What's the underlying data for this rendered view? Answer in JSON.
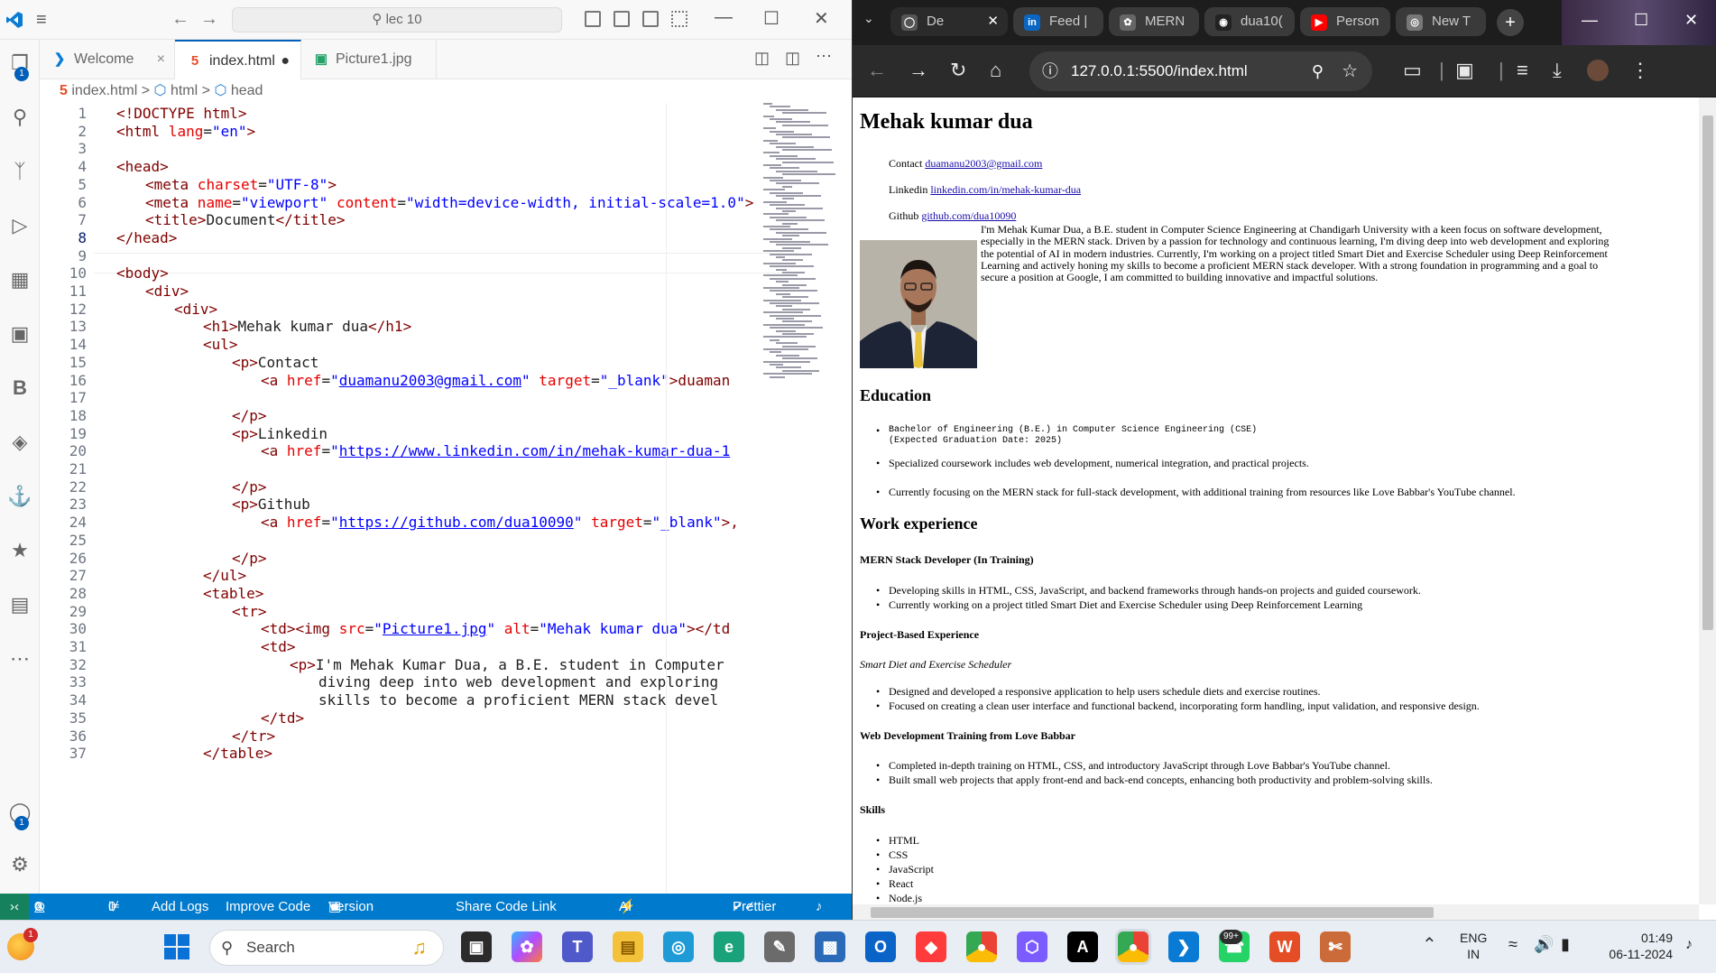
{
  "vscode": {
    "command_center": "lec 10",
    "tabs": [
      {
        "label": "Welcome",
        "icon": "vscode-icon"
      },
      {
        "label": "index.html",
        "icon": "html5-icon"
      },
      {
        "label": "Picture1.jpg",
        "icon": "image-icon"
      }
    ],
    "breadcrumb": {
      "file": "index.html",
      "sep": ">",
      "html": "html",
      "head": "head"
    },
    "line_numbers": [
      "1",
      "2",
      "3",
      "4",
      "5",
      "6",
      "7",
      "8",
      "9",
      "10",
      "11",
      "12",
      "13",
      "14",
      "15",
      "16",
      "17",
      "18",
      "19",
      "20",
      "21",
      "22",
      "23",
      "24",
      "25",
      "26",
      "27",
      "28",
      "29",
      "30",
      "31",
      "32",
      "33",
      "34",
      "35",
      "36",
      "37"
    ],
    "code": {
      "l1": "<!DOCTYPE html>",
      "l2a": "<html",
      "l2b": " lang",
      "l2c": "=",
      "l2d": "\"en\"",
      "l2e": ">",
      "l4": "<head>",
      "l5a": "<meta",
      "l5b": " charset",
      "l5c": "=",
      "l5d": "\"UTF-8\"",
      "l5e": ">",
      "l6a": "<meta",
      "l6b": " name",
      "l6c": "=",
      "l6d": "\"viewport\"",
      "l6e": " content",
      "l6f": "=",
      "l6g": "\"width=device-width, initial-scale=1.0\"",
      "l6h": ">",
      "l7a": "<title>",
      "l7b": "Document",
      "l7c": "</title>",
      "l8": "</head>",
      "l10": "<body>",
      "l11": "<div>",
      "l12": "<div>",
      "l13a": "<h1>",
      "l13b": "Mehak kumar dua",
      "l13c": "</h1>",
      "l14": "<ul>",
      "l15a": "<p>",
      "l15b": "Contact",
      "l16a": "<a",
      "l16b": " href",
      "l16c": "=",
      "l16d": "\"",
      "l16e": "duamanu2003@gmail.com",
      "l16f": "\"",
      "l16g": " target",
      "l16h": "=",
      "l16i": "\"_blank\"",
      "l16j": ">duaman",
      "l18": "</p>",
      "l19a": "<p>",
      "l19b": "Linkedin",
      "l20a": "<a",
      "l20b": " href",
      "l20c": "=",
      "l20d": "\"",
      "l20e": "https://www.linkedin.com/in/mehak-kumar-dua-1",
      "l22": "</p>",
      "l23a": "<p>",
      "l23b": "Github",
      "l24a": "<a",
      "l24b": " href",
      "l24c": "=",
      "l24d": "\"",
      "l24e": "https://github.com/dua10090",
      "l24f": "\"",
      "l24g": " target",
      "l24h": "=",
      "l24i": "\"_blank\"",
      "l24j": ">,",
      "l26": "</p>",
      "l27": "</ul>",
      "l28": "<table>",
      "l29": "<tr>",
      "l30a": "<td><img",
      "l30b": " src",
      "l30c": "=",
      "l30d": "\"",
      "l30e": "Picture1.jpg",
      "l30f": "\"",
      "l30g": " alt",
      "l30h": "=",
      "l30i": "\"Mehak kumar dua\"",
      "l30j": "></td",
      "l31": "<td>",
      "l32a": "<p>",
      "l32b": "I'm Mehak Kumar Dua, a B.E. student in Computer",
      "l33": "diving deep into web development and exploring",
      "l34": "skills to become a proficient MERN stack devel",
      "l35": "</td>",
      "l36": "</tr>",
      "l37": "</table>"
    },
    "status": {
      "errors": "0",
      "warnings": "0",
      "ports": "0",
      "add_logs": "Add Logs",
      "improve_code": "Improve Code",
      "version_control": "Version Control",
      "share_code": "Share Code Link",
      "ai_chat": "AI Code Chat",
      "prettier": "Prettier"
    },
    "badges": {
      "explorer": "1",
      "accounts": "1"
    }
  },
  "browser": {
    "tabs": [
      "De",
      "Feed |",
      "MERN",
      "dua10(",
      "Person",
      "New T"
    ],
    "url": "127.0.0.1:5500/index.html",
    "page": {
      "name": "Mehak kumar dua",
      "contact_label": "Contact",
      "contact_link": "duamanu2003@gmail.com",
      "linkedin_label": "Linkedin",
      "linkedin_link": "linkedin.com/in/mehak-kumar-dua",
      "github_label": "Github",
      "github_link": "github.com/dua10090",
      "bio_lines": [
        "I'm Mehak Kumar Dua, a B.E. student in Computer Science Engineering at Chandigarh University with a keen focus on software development,",
        "especially in the MERN stack. Driven by a passion for technology and continuous learning, I'm diving deep into web development and exploring",
        "the potential of AI in modern industries. Currently, I'm working on a project titled Smart Diet and Exercise Scheduler using Deep Reinforcement",
        "Learning and actively honing my skills to become a proficient MERN stack developer. With a strong foundation in programming and a goal to",
        "secure a position at Google, I am committed to building innovative and impactful solutions."
      ],
      "education_heading": "Education",
      "edu_item1_line1": "Bachelor of Engineering (B.E.) in Computer Science Engineering (CSE)",
      "edu_item1_line2": "(Expected Graduation Date: 2025)",
      "edu_item2": "Specialized coursework includes web development, numerical integration, and practical projects.",
      "edu_item3": "Currently focusing on the MERN stack for full-stack development, with additional training from resources like Love Babbar's YouTube channel.",
      "work_heading": "Work experience",
      "mern_heading": "MERN Stack Developer (In Training)",
      "mern_items": [
        "Developing skills in HTML, CSS, JavaScript, and backend frameworks through hands-on projects and guided coursework.",
        "Currently working on a project titled Smart Diet and Exercise Scheduler using Deep Reinforcement Learning"
      ],
      "project_heading": "Project-Based Experience",
      "project_title": "Smart Diet and Exercise Scheduler",
      "project_items": [
        "Designed and developed a responsive application to help users schedule diets and exercise routines.",
        "Focused on creating a clean user interface and functional backend, incorporating form handling, input validation, and responsive design."
      ],
      "lovebabbar_heading": "Web Development Training from Love Babbar",
      "lovebabbar_items": [
        "Completed in-depth training on HTML, CSS, and introductory JavaScript through Love Babbar's YouTube channel.",
        "Built small web projects that apply front-end and back-end concepts, enhancing both productivity and problem-solving skills."
      ],
      "skills_heading": "Skills",
      "skills": [
        "HTML",
        "CSS",
        "JavaScript",
        "React",
        "Node.js"
      ]
    }
  },
  "taskbar": {
    "search_label": "Search",
    "notification_count": "1",
    "whatsapp_badge": "99+",
    "lang_top": "ENG",
    "lang_bottom": "IN",
    "time": "01:49",
    "date": "06-11-2024"
  }
}
